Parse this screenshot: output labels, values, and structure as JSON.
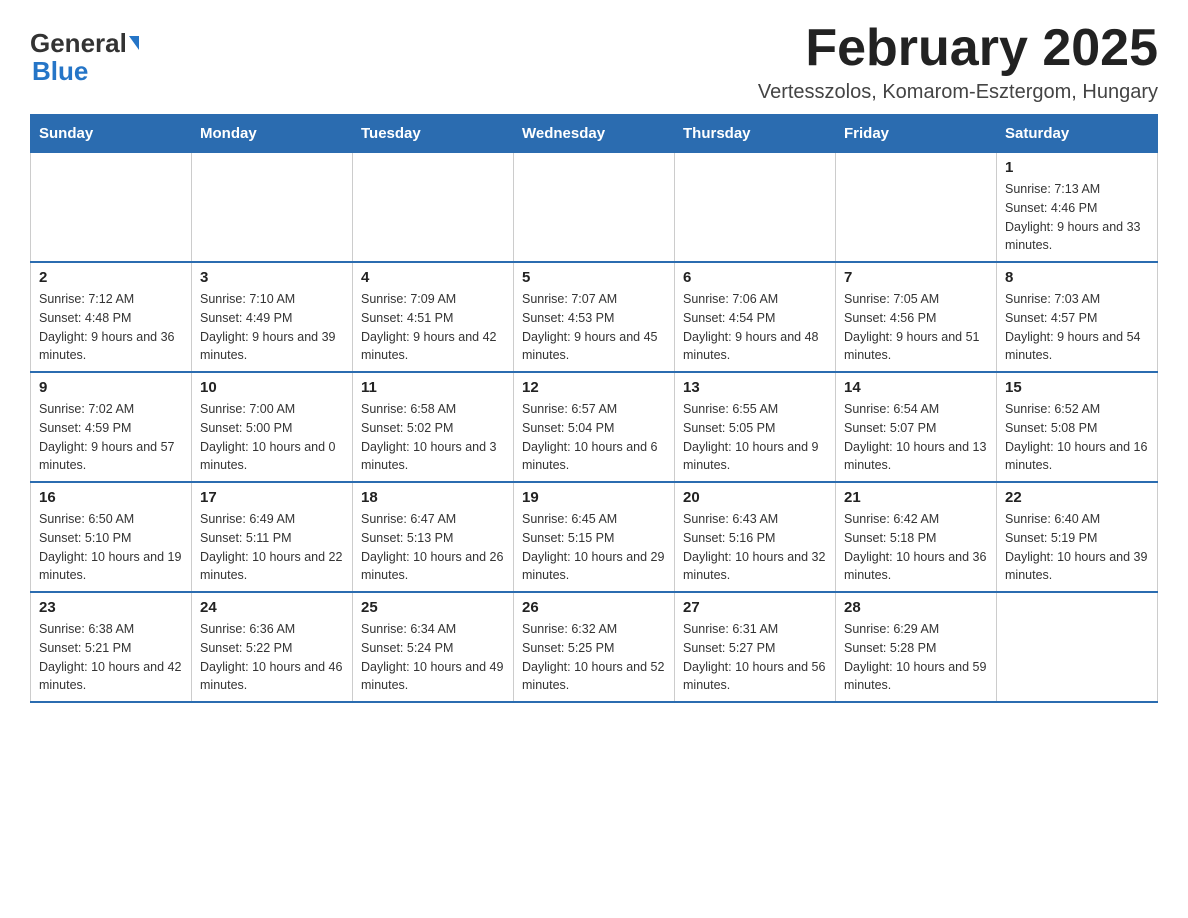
{
  "header": {
    "logo_general": "General",
    "logo_blue": "Blue",
    "title": "February 2025",
    "subtitle": "Vertesszolos, Komarom-Esztergom, Hungary"
  },
  "days_of_week": [
    "Sunday",
    "Monday",
    "Tuesday",
    "Wednesday",
    "Thursday",
    "Friday",
    "Saturday"
  ],
  "weeks": [
    {
      "days": [
        {
          "number": "",
          "info": ""
        },
        {
          "number": "",
          "info": ""
        },
        {
          "number": "",
          "info": ""
        },
        {
          "number": "",
          "info": ""
        },
        {
          "number": "",
          "info": ""
        },
        {
          "number": "",
          "info": ""
        },
        {
          "number": "1",
          "info": "Sunrise: 7:13 AM\nSunset: 4:46 PM\nDaylight: 9 hours and 33 minutes."
        }
      ]
    },
    {
      "days": [
        {
          "number": "2",
          "info": "Sunrise: 7:12 AM\nSunset: 4:48 PM\nDaylight: 9 hours and 36 minutes."
        },
        {
          "number": "3",
          "info": "Sunrise: 7:10 AM\nSunset: 4:49 PM\nDaylight: 9 hours and 39 minutes."
        },
        {
          "number": "4",
          "info": "Sunrise: 7:09 AM\nSunset: 4:51 PM\nDaylight: 9 hours and 42 minutes."
        },
        {
          "number": "5",
          "info": "Sunrise: 7:07 AM\nSunset: 4:53 PM\nDaylight: 9 hours and 45 minutes."
        },
        {
          "number": "6",
          "info": "Sunrise: 7:06 AM\nSunset: 4:54 PM\nDaylight: 9 hours and 48 minutes."
        },
        {
          "number": "7",
          "info": "Sunrise: 7:05 AM\nSunset: 4:56 PM\nDaylight: 9 hours and 51 minutes."
        },
        {
          "number": "8",
          "info": "Sunrise: 7:03 AM\nSunset: 4:57 PM\nDaylight: 9 hours and 54 minutes."
        }
      ]
    },
    {
      "days": [
        {
          "number": "9",
          "info": "Sunrise: 7:02 AM\nSunset: 4:59 PM\nDaylight: 9 hours and 57 minutes."
        },
        {
          "number": "10",
          "info": "Sunrise: 7:00 AM\nSunset: 5:00 PM\nDaylight: 10 hours and 0 minutes."
        },
        {
          "number": "11",
          "info": "Sunrise: 6:58 AM\nSunset: 5:02 PM\nDaylight: 10 hours and 3 minutes."
        },
        {
          "number": "12",
          "info": "Sunrise: 6:57 AM\nSunset: 5:04 PM\nDaylight: 10 hours and 6 minutes."
        },
        {
          "number": "13",
          "info": "Sunrise: 6:55 AM\nSunset: 5:05 PM\nDaylight: 10 hours and 9 minutes."
        },
        {
          "number": "14",
          "info": "Sunrise: 6:54 AM\nSunset: 5:07 PM\nDaylight: 10 hours and 13 minutes."
        },
        {
          "number": "15",
          "info": "Sunrise: 6:52 AM\nSunset: 5:08 PM\nDaylight: 10 hours and 16 minutes."
        }
      ]
    },
    {
      "days": [
        {
          "number": "16",
          "info": "Sunrise: 6:50 AM\nSunset: 5:10 PM\nDaylight: 10 hours and 19 minutes."
        },
        {
          "number": "17",
          "info": "Sunrise: 6:49 AM\nSunset: 5:11 PM\nDaylight: 10 hours and 22 minutes."
        },
        {
          "number": "18",
          "info": "Sunrise: 6:47 AM\nSunset: 5:13 PM\nDaylight: 10 hours and 26 minutes."
        },
        {
          "number": "19",
          "info": "Sunrise: 6:45 AM\nSunset: 5:15 PM\nDaylight: 10 hours and 29 minutes."
        },
        {
          "number": "20",
          "info": "Sunrise: 6:43 AM\nSunset: 5:16 PM\nDaylight: 10 hours and 32 minutes."
        },
        {
          "number": "21",
          "info": "Sunrise: 6:42 AM\nSunset: 5:18 PM\nDaylight: 10 hours and 36 minutes."
        },
        {
          "number": "22",
          "info": "Sunrise: 6:40 AM\nSunset: 5:19 PM\nDaylight: 10 hours and 39 minutes."
        }
      ]
    },
    {
      "days": [
        {
          "number": "23",
          "info": "Sunrise: 6:38 AM\nSunset: 5:21 PM\nDaylight: 10 hours and 42 minutes."
        },
        {
          "number": "24",
          "info": "Sunrise: 6:36 AM\nSunset: 5:22 PM\nDaylight: 10 hours and 46 minutes."
        },
        {
          "number": "25",
          "info": "Sunrise: 6:34 AM\nSunset: 5:24 PM\nDaylight: 10 hours and 49 minutes."
        },
        {
          "number": "26",
          "info": "Sunrise: 6:32 AM\nSunset: 5:25 PM\nDaylight: 10 hours and 52 minutes."
        },
        {
          "number": "27",
          "info": "Sunrise: 6:31 AM\nSunset: 5:27 PM\nDaylight: 10 hours and 56 minutes."
        },
        {
          "number": "28",
          "info": "Sunrise: 6:29 AM\nSunset: 5:28 PM\nDaylight: 10 hours and 59 minutes."
        },
        {
          "number": "",
          "info": ""
        }
      ]
    }
  ]
}
